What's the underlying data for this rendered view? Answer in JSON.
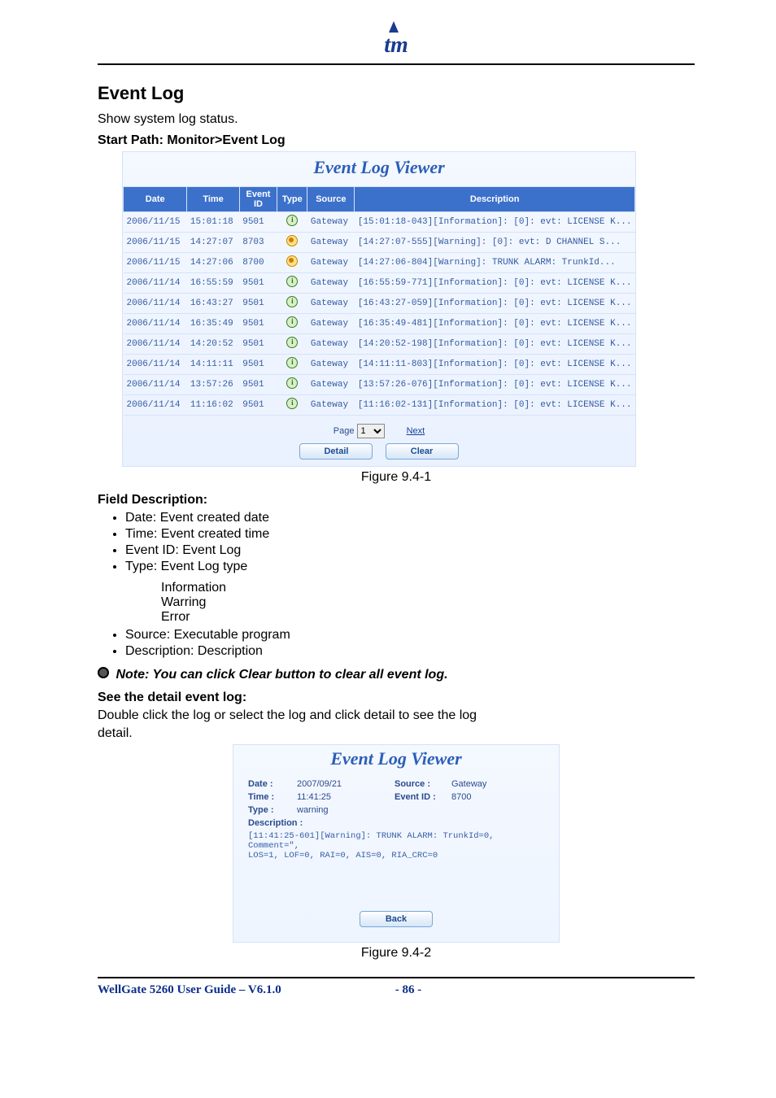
{
  "body": {
    "logo_text": "tm",
    "section_heading": "Event Log",
    "intro": "Show system log status.",
    "path_line": "Start Path: Monitor>Event Log",
    "figure1_caption": "Figure 9.4-1",
    "figure2_caption": "Figure 9.4-2",
    "field_description_heading": "Field Description:",
    "field_items": [
      "Date: Event created date",
      "Time: Event created time",
      "Event ID: Event Log",
      "Type: Event Log type",
      "Source: Executable program",
      "Description: Description"
    ],
    "type_sub": [
      "Information",
      "Warring",
      "Error"
    ],
    "note": "Note: You can click Clear button to clear all event log.",
    "detail_heading": "See the detail event log:",
    "detail_body_line1": "Double click the log or select the log and click detail to see the log",
    "detail_body_line2": "detail."
  },
  "viewer1": {
    "title": "Event Log Viewer",
    "columns": [
      "Date",
      "Time",
      "Event ID",
      "Type",
      "Source",
      "Description"
    ],
    "rows": [
      {
        "date": "2006/11/15",
        "time": "15:01:18",
        "id": "9501",
        "type": "info",
        "source": "Gateway",
        "desc": "[15:01:18-043][Information]: [0]: evt: LICENSE K..."
      },
      {
        "date": "2006/11/15",
        "time": "14:27:07",
        "id": "8703",
        "type": "warn",
        "source": "Gateway",
        "desc": "[14:27:07-555][Warning]: [0]: evt: D CHANNEL S..."
      },
      {
        "date": "2006/11/15",
        "time": "14:27:06",
        "id": "8700",
        "type": "warn",
        "source": "Gateway",
        "desc": "[14:27:06-804][Warning]: TRUNK ALARM: TrunkId..."
      },
      {
        "date": "2006/11/14",
        "time": "16:55:59",
        "id": "9501",
        "type": "info",
        "source": "Gateway",
        "desc": "[16:55:59-771][Information]: [0]: evt: LICENSE K..."
      },
      {
        "date": "2006/11/14",
        "time": "16:43:27",
        "id": "9501",
        "type": "info",
        "source": "Gateway",
        "desc": "[16:43:27-059][Information]: [0]: evt: LICENSE K..."
      },
      {
        "date": "2006/11/14",
        "time": "16:35:49",
        "id": "9501",
        "type": "info",
        "source": "Gateway",
        "desc": "[16:35:49-481][Information]: [0]: evt: LICENSE K..."
      },
      {
        "date": "2006/11/14",
        "time": "14:20:52",
        "id": "9501",
        "type": "info",
        "source": "Gateway",
        "desc": "[14:20:52-198][Information]: [0]: evt: LICENSE K..."
      },
      {
        "date": "2006/11/14",
        "time": "14:11:11",
        "id": "9501",
        "type": "info",
        "source": "Gateway",
        "desc": "[14:11:11-803][Information]: [0]: evt: LICENSE K..."
      },
      {
        "date": "2006/11/14",
        "time": "13:57:26",
        "id": "9501",
        "type": "info",
        "source": "Gateway",
        "desc": "[13:57:26-076][Information]: [0]: evt: LICENSE K..."
      },
      {
        "date": "2006/11/14",
        "time": "11:16:02",
        "id": "9501",
        "type": "info",
        "source": "Gateway",
        "desc": "[11:16:02-131][Information]: [0]: evt: LICENSE K..."
      }
    ],
    "pager_label": "Page",
    "pager_value": "1",
    "next_label": "Next",
    "detail_btn": "Detail",
    "clear_btn": "Clear"
  },
  "viewer2": {
    "title": "Event Log Viewer",
    "labels": {
      "date": "Date :",
      "time": "Time :",
      "type": "Type :",
      "source": "Source :",
      "eventid": "Event ID :",
      "desc": "Description :"
    },
    "values": {
      "date": "2007/09/21",
      "time": "11:41:25",
      "type": "warning",
      "source": "Gateway",
      "eventid": "8700"
    },
    "description_lines": [
      "[11:41:25-601][Warning]: TRUNK ALARM: TrunkId=0, Comment=\",",
      "LOS=1, LOF=0, RAI=0, AIS=0, RIA_CRC=0"
    ],
    "back_btn": "Back"
  },
  "footer": {
    "left": "WellGate 5260 User Guide – V6.1.0",
    "page": "- 86 -"
  }
}
